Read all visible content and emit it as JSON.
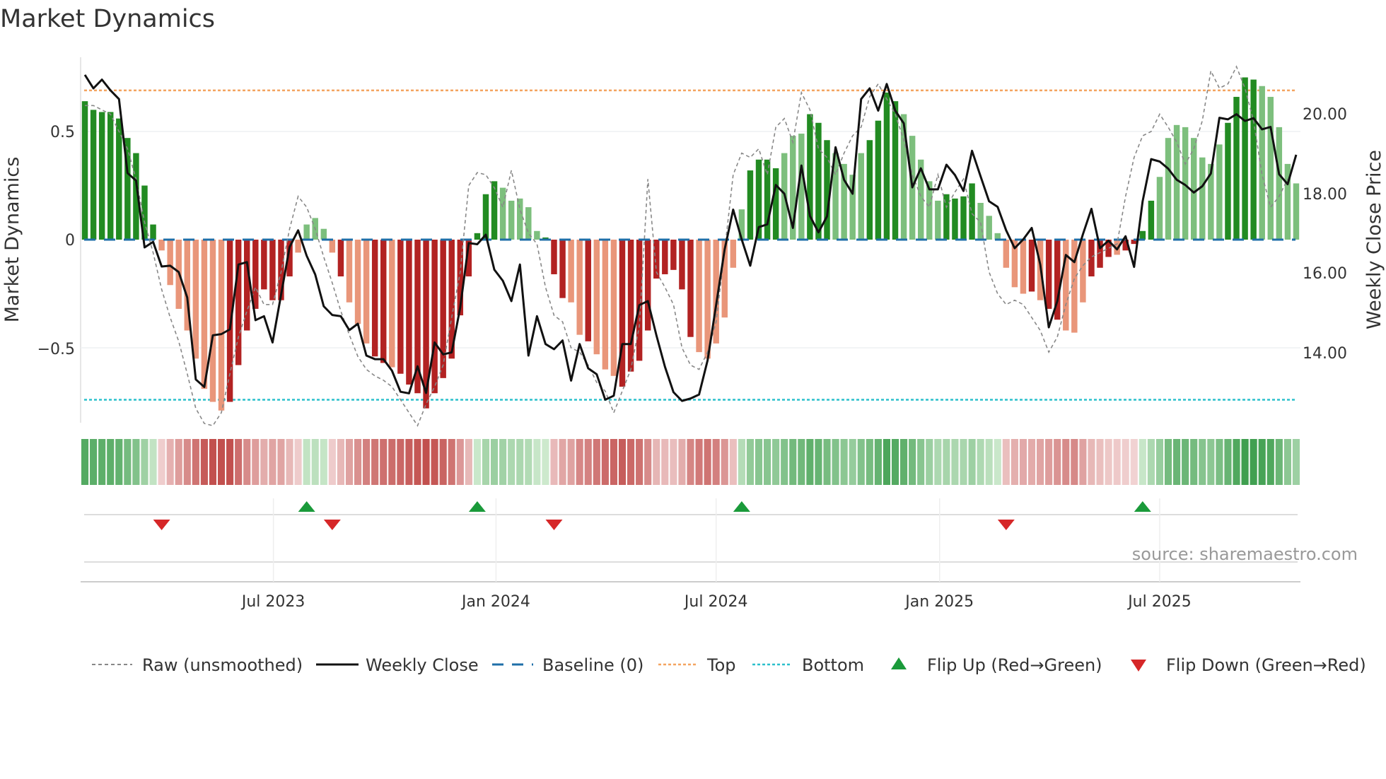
{
  "chart_data": {
    "type": "bar",
    "title": "Market Dynamics",
    "ylabel": "Market Dynamics",
    "ylabel_right": "Weekly Close Price",
    "ylim": [
      -0.86,
      0.87
    ],
    "ylim_right": [
      12.5,
      21.6
    ],
    "yticks": [
      {
        "v": 0.5,
        "label": "0.5"
      },
      {
        "v": 0,
        "label": "0"
      },
      {
        "v": -0.5,
        "label": "−0.5"
      }
    ],
    "yticks_right": [
      {
        "v": 20,
        "label": "20.00"
      },
      {
        "v": 18,
        "label": "18.00"
      },
      {
        "v": 16,
        "label": "16.00"
      },
      {
        "v": 14,
        "label": "14.00"
      }
    ],
    "xticks": [
      {
        "week": 23.1,
        "label": "Jul 2023"
      },
      {
        "week": 49.2,
        "label": "Jan 2024"
      },
      {
        "week": 75.0,
        "label": "Jul 2024"
      },
      {
        "week": 101.2,
        "label": "Jan 2025"
      },
      {
        "week": 127.0,
        "label": "Jul 2025"
      }
    ],
    "top_level": 0.69,
    "bottom_level": -0.74,
    "baseline": 0,
    "dynamics": [
      0.64,
      0.6,
      0.59,
      0.59,
      0.56,
      0.47,
      0.4,
      0.25,
      0.07,
      -0.05,
      -0.21,
      -0.32,
      -0.42,
      -0.55,
      -0.69,
      -0.75,
      -0.79,
      -0.75,
      -0.58,
      -0.42,
      -0.32,
      -0.23,
      -0.28,
      -0.28,
      -0.17,
      -0.06,
      0.07,
      0.1,
      0.05,
      -0.06,
      -0.17,
      -0.29,
      -0.39,
      -0.48,
      -0.54,
      -0.57,
      -0.59,
      -0.62,
      -0.67,
      -0.71,
      -0.78,
      -0.71,
      -0.64,
      -0.55,
      -0.35,
      -0.17,
      0.03,
      0.21,
      0.27,
      0.24,
      0.18,
      0.19,
      0.15,
      0.04,
      0.01,
      -0.16,
      -0.27,
      -0.29,
      -0.44,
      -0.47,
      -0.53,
      -0.6,
      -0.63,
      -0.68,
      -0.61,
      -0.56,
      -0.42,
      -0.18,
      -0.16,
      -0.14,
      -0.23,
      -0.45,
      -0.52,
      -0.55,
      -0.48,
      -0.36,
      -0.13,
      0.14,
      0.32,
      0.37,
      0.37,
      0.33,
      0.4,
      0.48,
      0.49,
      0.58,
      0.54,
      0.46,
      0.4,
      0.35,
      0.3,
      0.4,
      0.46,
      0.55,
      0.68,
      0.64,
      0.58,
      0.48,
      0.37,
      0.27,
      0.18,
      0.21,
      0.19,
      0.2,
      0.26,
      0.17,
      0.11,
      0.03,
      -0.13,
      -0.22,
      -0.25,
      -0.24,
      -0.28,
      -0.32,
      -0.37,
      -0.42,
      -0.43,
      -0.29,
      -0.17,
      -0.13,
      -0.08,
      -0.07,
      -0.05,
      -0.02,
      0.04,
      0.18,
      0.29,
      0.47,
      0.53,
      0.52,
      0.47,
      0.38,
      0.35,
      0.44,
      0.54,
      0.66,
      0.75,
      0.74,
      0.71,
      0.66,
      0.52,
      0.35,
      0.26
    ],
    "strong": "11111111100000000111111110000010001101111111111110000011100100011111111100000011110001110000111100000111100000010110001110111100000000111100000111100000",
    "raw": [
      0.62,
      0.62,
      0.6,
      0.58,
      0.5,
      0.42,
      0.28,
      0.08,
      -0.06,
      -0.23,
      -0.36,
      -0.47,
      -0.62,
      -0.78,
      -0.85,
      -0.86,
      -0.8,
      -0.62,
      -0.45,
      -0.33,
      -0.22,
      -0.3,
      -0.3,
      -0.15,
      0.05,
      0.2,
      0.15,
      0.05,
      -0.08,
      -0.2,
      -0.33,
      -0.44,
      -0.54,
      -0.6,
      -0.63,
      -0.65,
      -0.68,
      -0.74,
      -0.8,
      -0.86,
      -0.76,
      -0.68,
      -0.58,
      -0.36,
      -0.15,
      0.25,
      0.31,
      0.3,
      0.24,
      0.15,
      0.32,
      0.14,
      0.03,
      -0.02,
      -0.22,
      -0.35,
      -0.38,
      -0.5,
      -0.52,
      -0.58,
      -0.66,
      -0.7,
      -0.8,
      -0.7,
      -0.6,
      -0.4,
      0.28,
      -0.15,
      -0.22,
      -0.3,
      -0.5,
      -0.58,
      -0.6,
      -0.52,
      -0.38,
      -0.05,
      0.3,
      0.4,
      0.38,
      0.42,
      0.3,
      0.52,
      0.56,
      0.45,
      0.68,
      0.6,
      0.42,
      0.38,
      0.3,
      0.4,
      0.48,
      0.52,
      0.66,
      0.72,
      0.65,
      0.58,
      0.46,
      0.3,
      0.2,
      0.15,
      0.3,
      0.15,
      0.22,
      0.28,
      0.12,
      0.08,
      -0.15,
      -0.25,
      -0.3,
      -0.28,
      -0.3,
      -0.36,
      -0.42,
      -0.52,
      -0.45,
      -0.3,
      -0.18,
      -0.12,
      -0.08,
      -0.06,
      -0.04,
      -0.02,
      0.2,
      0.38,
      0.48,
      0.5,
      0.58,
      0.52,
      0.45,
      0.35,
      0.42,
      0.55,
      0.78,
      0.7,
      0.72,
      0.8,
      0.7,
      0.55,
      0.3,
      0.15,
      0.2,
      0.28
    ],
    "close": [
      20.98,
      20.64,
      20.86,
      20.59,
      20.37,
      18.51,
      18.32,
      16.64,
      16.78,
      16.16,
      16.18,
      16.02,
      15.38,
      13.32,
      13.13,
      14.43,
      14.46,
      14.58,
      16.21,
      16.27,
      14.81,
      14.91,
      14.25,
      15.45,
      16.65,
      17.07,
      16.43,
      15.96,
      15.16,
      14.94,
      14.91,
      14.56,
      14.72,
      13.92,
      13.83,
      13.83,
      13.54,
      13.01,
      12.97,
      13.65,
      12.98,
      14.25,
      13.95,
      14.0,
      15.13,
      16.75,
      16.72,
      16.96,
      16.08,
      15.8,
      15.29,
      16.21,
      13.92,
      14.91,
      14.21,
      14.08,
      14.3,
      13.29,
      14.21,
      13.6,
      13.45,
      12.81,
      12.91,
      14.21,
      14.21,
      15.19,
      15.29,
      14.43,
      13.64,
      13.0,
      12.78,
      12.84,
      12.94,
      13.8,
      15.19,
      16.59,
      17.59,
      16.84,
      16.18,
      17.15,
      17.22,
      18.21,
      17.99,
      17.13,
      18.7,
      17.43,
      17.02,
      17.42,
      19.16,
      18.34,
      17.99,
      20.37,
      20.64,
      20.08,
      20.75,
      20.08,
      19.76,
      18.15,
      18.63,
      18.1,
      18.1,
      18.72,
      18.46,
      18.06,
      19.07,
      18.43,
      17.8,
      17.66,
      17.07,
      16.62,
      16.84,
      17.13,
      16.21,
      14.63,
      15.29,
      16.45,
      16.27,
      16.97,
      17.61,
      16.62,
      16.81,
      16.59,
      16.92,
      16.15,
      17.8,
      18.86,
      18.8,
      18.62,
      18.34,
      18.21,
      18.02,
      18.18,
      18.5,
      19.9,
      19.86,
      19.99,
      19.82,
      19.89,
      19.61,
      19.67,
      18.48,
      18.23,
      18.97
    ],
    "flip_up_weeks": [
      27,
      47,
      78,
      125
    ],
    "flip_down_weeks": [
      10,
      30,
      56,
      109
    ],
    "legend": {
      "placement": "bottom",
      "raw": "Raw (unsmoothed)",
      "close": "Weekly Close",
      "baseline": "Baseline (0)",
      "top": "Top",
      "bottom": "Bottom",
      "flip_up": "Flip Up (Red→Green)",
      "flip_down": "Flip Down (Green→Red)"
    },
    "source": "source: sharemaestro.com"
  },
  "colors": {
    "green_strong": "#228b22",
    "green_light": "#7dbf7d",
    "red_strong": "#b22222",
    "red_light": "#e9967a",
    "top": "#f4a460",
    "bottom": "#2bc0cc",
    "baseline": "#1f6fa8",
    "flip_up": "#1a9a3a",
    "flip_down": "#d62728"
  }
}
